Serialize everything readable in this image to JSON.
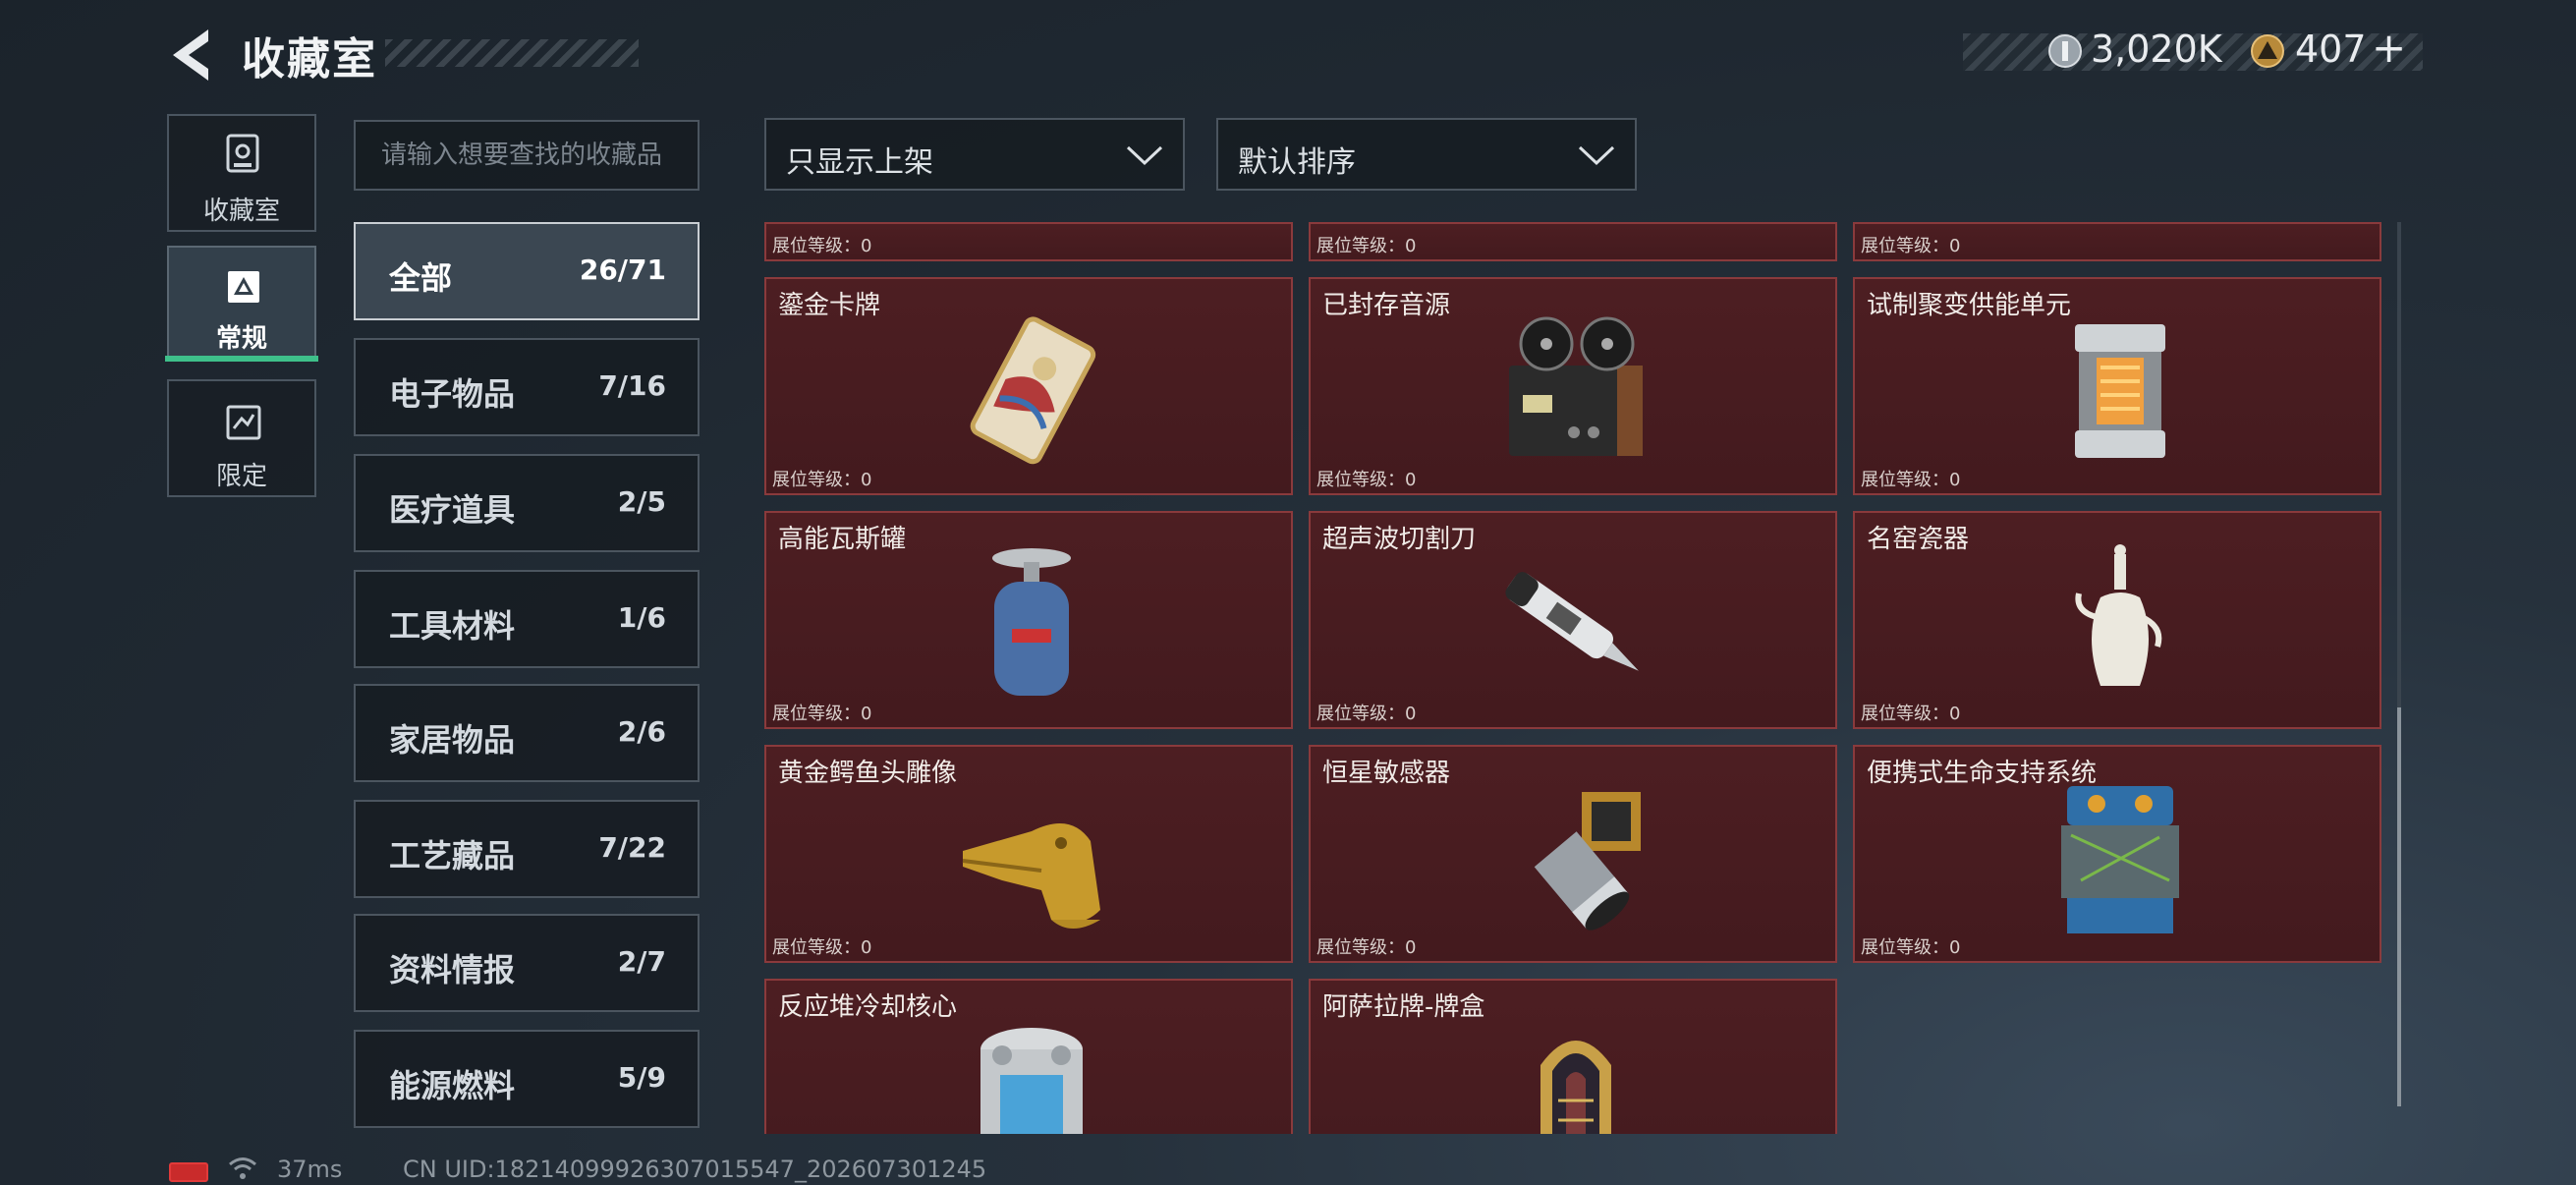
{
  "header": {
    "title": "收藏室",
    "currency1_value": "3,020K",
    "currency2_value": "407",
    "currency2_add": "+"
  },
  "nav": [
    {
      "label": "收藏室",
      "icon": "trophy-cabinet-icon"
    },
    {
      "label": "常规",
      "icon": "triangle-card-icon"
    },
    {
      "label": "限定",
      "icon": "limited-card-icon"
    }
  ],
  "search": {
    "placeholder": "请输入想要查找的收藏品"
  },
  "filters": {
    "display": "只显示上架",
    "sort": "默认排序"
  },
  "categories": [
    {
      "name": "全部",
      "count": "26/71"
    },
    {
      "name": "电子物品",
      "count": "7/16"
    },
    {
      "name": "医疗道具",
      "count": "2/5"
    },
    {
      "name": "工具材料",
      "count": "1/6"
    },
    {
      "name": "家居物品",
      "count": "2/6"
    },
    {
      "name": "工艺藏品",
      "count": "7/22"
    },
    {
      "name": "资料情报",
      "count": "2/7"
    },
    {
      "name": "能源燃料",
      "count": "5/9"
    }
  ],
  "level_label": "展位等级：0",
  "items": [
    {
      "name": "鎏金卡牌",
      "icon": "gilded-card-icon"
    },
    {
      "name": "已封存音源",
      "icon": "reel-tape-recorder-icon"
    },
    {
      "name": "试制聚变供能单元",
      "icon": "fusion-cell-icon"
    },
    {
      "name": "高能瓦斯罐",
      "icon": "gas-canister-icon"
    },
    {
      "name": "超声波切割刀",
      "icon": "ultrasonic-cutter-icon"
    },
    {
      "name": "名窑瓷器",
      "icon": "porcelain-ewer-icon"
    },
    {
      "name": "黄金鳄鱼头雕像",
      "icon": "gold-crocodile-head-icon"
    },
    {
      "name": "恒星敏感器",
      "icon": "star-sensor-icon"
    },
    {
      "name": "便携式生命支持系统",
      "icon": "life-support-pack-icon"
    },
    {
      "name": "反应堆冷却核心",
      "icon": "reactor-core-icon"
    },
    {
      "name": "阿萨拉牌-牌盒",
      "icon": "card-box-icon"
    }
  ],
  "footer": {
    "ping": "37ms",
    "uid": "CN UID:18214099926307015547_202607301245"
  }
}
